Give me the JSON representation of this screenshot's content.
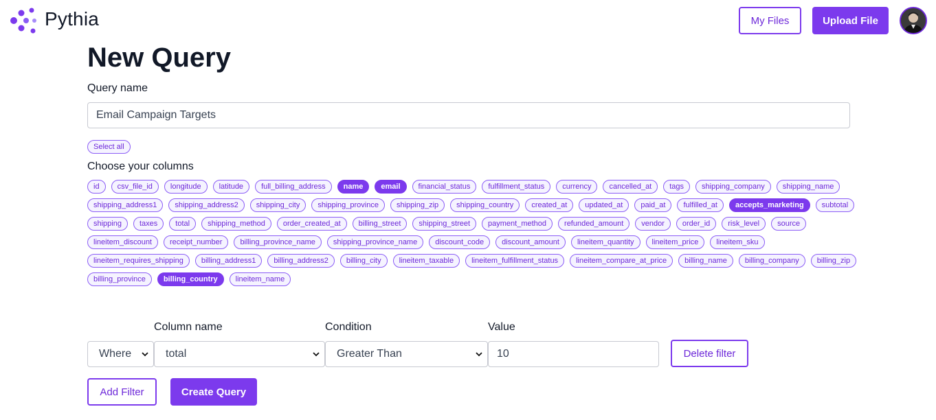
{
  "header": {
    "brand": "Pythia",
    "my_files_label": "My Files",
    "upload_label": "Upload File",
    "accent_color": "#7c3aed"
  },
  "page": {
    "title": "New Query"
  },
  "query": {
    "name_label": "Query name",
    "name_value": "Email Campaign Targets"
  },
  "columns": {
    "select_all_label": "Select all",
    "label": "Choose your columns",
    "items": [
      {
        "label": "id",
        "selected": false
      },
      {
        "label": "csv_file_id",
        "selected": false
      },
      {
        "label": "longitude",
        "selected": false
      },
      {
        "label": "latitude",
        "selected": false
      },
      {
        "label": "full_billing_address",
        "selected": false
      },
      {
        "label": "name",
        "selected": true
      },
      {
        "label": "email",
        "selected": true
      },
      {
        "label": "financial_status",
        "selected": false
      },
      {
        "label": "fulfillment_status",
        "selected": false
      },
      {
        "label": "currency",
        "selected": false
      },
      {
        "label": "cancelled_at",
        "selected": false
      },
      {
        "label": "tags",
        "selected": false
      },
      {
        "label": "shipping_company",
        "selected": false
      },
      {
        "label": "shipping_name",
        "selected": false
      },
      {
        "label": "shipping_address1",
        "selected": false
      },
      {
        "label": "shipping_address2",
        "selected": false
      },
      {
        "label": "shipping_city",
        "selected": false
      },
      {
        "label": "shipping_province",
        "selected": false
      },
      {
        "label": "shipping_zip",
        "selected": false
      },
      {
        "label": "shipping_country",
        "selected": false
      },
      {
        "label": "created_at",
        "selected": false
      },
      {
        "label": "updated_at",
        "selected": false
      },
      {
        "label": "paid_at",
        "selected": false
      },
      {
        "label": "fulfilled_at",
        "selected": false
      },
      {
        "label": "accepts_marketing",
        "selected": true
      },
      {
        "label": "subtotal",
        "selected": false
      },
      {
        "label": "shipping",
        "selected": false
      },
      {
        "label": "taxes",
        "selected": false
      },
      {
        "label": "total",
        "selected": false
      },
      {
        "label": "shipping_method",
        "selected": false
      },
      {
        "label": "order_created_at",
        "selected": false
      },
      {
        "label": "billing_street",
        "selected": false
      },
      {
        "label": "shipping_street",
        "selected": false
      },
      {
        "label": "payment_method",
        "selected": false
      },
      {
        "label": "refunded_amount",
        "selected": false
      },
      {
        "label": "vendor",
        "selected": false
      },
      {
        "label": "order_id",
        "selected": false
      },
      {
        "label": "risk_level",
        "selected": false
      },
      {
        "label": "source",
        "selected": false
      },
      {
        "label": "lineitem_discount",
        "selected": false
      },
      {
        "label": "receipt_number",
        "selected": false
      },
      {
        "label": "billing_province_name",
        "selected": false
      },
      {
        "label": "shipping_province_name",
        "selected": false
      },
      {
        "label": "discount_code",
        "selected": false
      },
      {
        "label": "discount_amount",
        "selected": false
      },
      {
        "label": "lineitem_quantity",
        "selected": false
      },
      {
        "label": "lineitem_price",
        "selected": false
      },
      {
        "label": "lineitem_sku",
        "selected": false
      },
      {
        "label": "lineitem_requires_shipping",
        "selected": false
      },
      {
        "label": "billing_address1",
        "selected": false
      },
      {
        "label": "billing_address2",
        "selected": false
      },
      {
        "label": "billing_city",
        "selected": false
      },
      {
        "label": "lineitem_taxable",
        "selected": false
      },
      {
        "label": "lineitem_fulfillment_status",
        "selected": false
      },
      {
        "label": "lineitem_compare_at_price",
        "selected": false
      },
      {
        "label": "billing_name",
        "selected": false
      },
      {
        "label": "billing_company",
        "selected": false
      },
      {
        "label": "billing_zip",
        "selected": false
      },
      {
        "label": "billing_province",
        "selected": false
      },
      {
        "label": "billing_country",
        "selected": true
      },
      {
        "label": "lineitem_name",
        "selected": false
      }
    ]
  },
  "filter": {
    "column_label": "Column name",
    "condition_label": "Condition",
    "value_label": "Value",
    "where_value": "Where",
    "column_value": "total",
    "condition_value": "Greater Than",
    "value": "10",
    "delete_label": "Delete filter"
  },
  "actions": {
    "add_filter_label": "Add Filter",
    "create_query_label": "Create Query"
  }
}
